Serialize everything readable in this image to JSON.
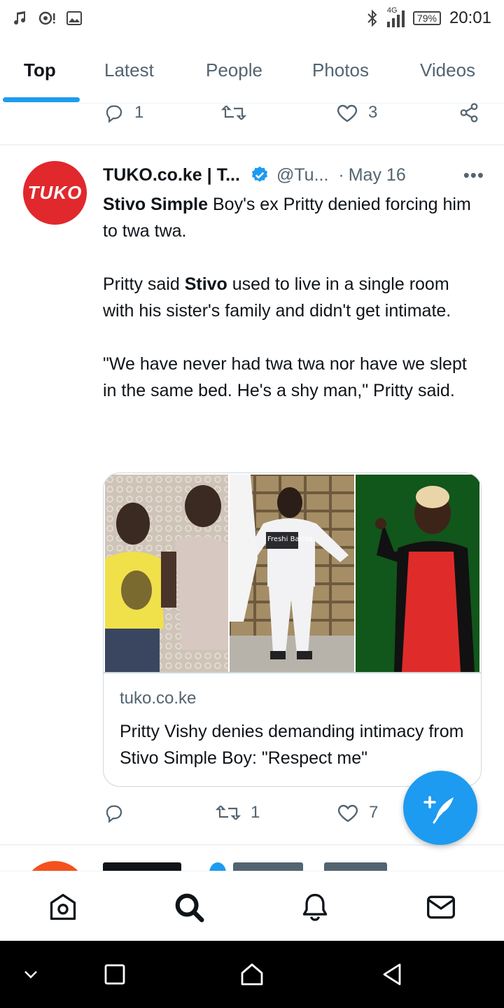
{
  "status_bar": {
    "network": "4G",
    "battery": "79%",
    "time": "20:01"
  },
  "tabs": [
    {
      "label": "Top",
      "active": true
    },
    {
      "label": "Latest",
      "active": false
    },
    {
      "label": "People",
      "active": false
    },
    {
      "label": "Photos",
      "active": false
    },
    {
      "label": "Videos",
      "active": false
    }
  ],
  "previous_tweet": {
    "reply_count": "1",
    "retweet_count": "",
    "like_count": "3"
  },
  "tweet": {
    "avatar_text": "TUKO",
    "author": "TUKO.co.ke | T...",
    "handle": "@Tu...",
    "separator": "·",
    "date": "May 16",
    "more": "•••",
    "text": {
      "p1_bold": "Stivo Simple",
      "p1_rest": " Boy's ex Pritty denied forcing him to twa twa.",
      "p2_start": "Pritty said ",
      "p2_bold": "Stivo",
      "p2_rest": " used to live in a single room with his sister's family and didn't get intimate.",
      "p3": "\"We have never had twa twa nor have we slept in the same bed. He's a shy man,\" Pritty said."
    },
    "card": {
      "domain": "tuko.co.ke",
      "title": "Pritty Vishy denies demanding intimacy from Stivo Simple Boy: \"Respect me\"",
      "image_text": "Freshi Barida."
    },
    "reply_count": "",
    "retweet_count": "1",
    "like_count": "7"
  },
  "colors": {
    "accent": "#1d9bf0",
    "secondary_text": "#536471",
    "tuko_red": "#e0282d"
  },
  "icons": {
    "bottom_nav": [
      "home-icon",
      "search-icon",
      "notifications-icon",
      "messages-icon"
    ],
    "system_nav": [
      "chevron-down-icon",
      "recents-icon",
      "home-outline-icon",
      "back-icon"
    ]
  }
}
